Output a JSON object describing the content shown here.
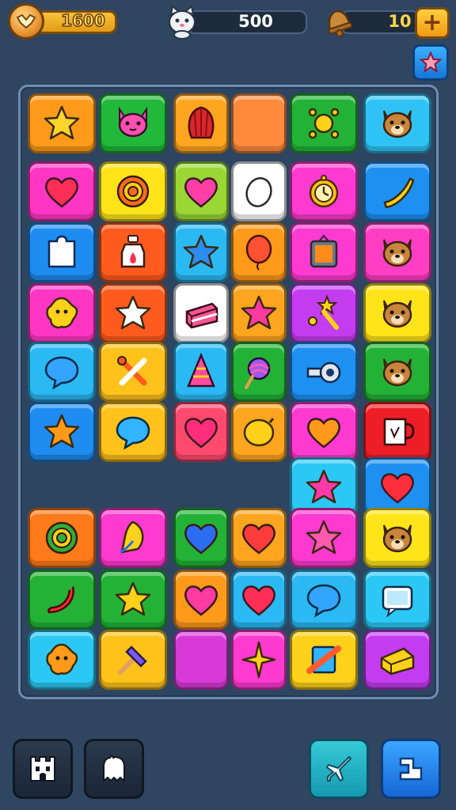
{
  "hud": {
    "coins": "1600",
    "score": "500",
    "bells": "10",
    "plus_label": "+"
  },
  "board": {
    "tiles": [
      {
        "color": "#ff9a1a",
        "icon": "star",
        "fg": "#ffd52b"
      },
      {
        "color": "#22b83a",
        "icon": "cat",
        "fg": "#ff4fb0"
      },
      {
        "color": "#ffa51f",
        "icon": "shell",
        "fg": "#d8262c"
      },
      {
        "color": "#ff8a3c",
        "icon": "none",
        "fg": "#ff8a3c"
      },
      {
        "color": "#23b236",
        "icon": "sun",
        "fg": "#ffd11a"
      },
      {
        "color": "#2fc3f5",
        "icon": "dog",
        "fg": "#c9853b"
      },
      {
        "color": "#ff36c4",
        "icon": "heart",
        "fg": "#ff2e56"
      },
      {
        "color": "#ffe41a",
        "icon": "target",
        "fg": "#ff6d1a"
      },
      {
        "color": "#9ad735",
        "icon": "heart",
        "fg": "#ff3fa8"
      },
      {
        "color": "#ffffff",
        "icon": "egg",
        "fg": "#ffffff"
      },
      {
        "color": "#ff3ad0",
        "icon": "clock",
        "fg": "#ffc21a"
      },
      {
        "color": "#1e90f2",
        "icon": "banana",
        "fg": "#ffd11a"
      },
      {
        "color": "#1e8cf0",
        "icon": "puzzle",
        "fg": "#ffffff"
      },
      {
        "color": "#ff5b1e",
        "icon": "bottle",
        "fg": "#ffffff"
      },
      {
        "color": "#2bb9f3",
        "icon": "star",
        "fg": "#2c8cf0"
      },
      {
        "color": "#ff9a1a",
        "icon": "balloon",
        "fg": "#ff5133"
      },
      {
        "color": "#ff3ad0",
        "icon": "frame",
        "fg": "#ff8c1a"
      },
      {
        "color": "#ff3ec4",
        "icon": "dog",
        "fg": "#c9853b"
      },
      {
        "color": "#ff36c4",
        "icon": "blob",
        "fg": "#ffd11a"
      },
      {
        "color": "#ff5b1e",
        "icon": "star",
        "fg": "#ffffff"
      },
      {
        "color": "#ffffff",
        "icon": "cake",
        "fg": "#ff5590"
      },
      {
        "color": "#ffa51f",
        "icon": "star",
        "fg": "#ff3aa0"
      },
      {
        "color": "#c43cf0",
        "icon": "wand",
        "fg": "#ffd11a"
      },
      {
        "color": "#ffe41a",
        "icon": "dog",
        "fg": "#c9853b"
      },
      {
        "color": "#2bb9f3",
        "icon": "bubble",
        "fg": "#33a4ff"
      },
      {
        "color": "#ffc21a",
        "icon": "tools",
        "fg": "#ff5b1e"
      },
      {
        "color": "#2bb9f3",
        "icon": "cone",
        "fg": "#ff4aa0"
      },
      {
        "color": "#23b236",
        "icon": "candy",
        "fg": "#9b5af0"
      },
      {
        "color": "#1e90f2",
        "icon": "whistle",
        "fg": "#e0e6f0"
      },
      {
        "color": "#23b236",
        "icon": "dog",
        "fg": "#c9853b"
      },
      {
        "color": "#1e8cf0",
        "icon": "star",
        "fg": "#ff9a1a"
      },
      {
        "color": "#ffc21a",
        "icon": "bubble",
        "fg": "#33b4ff"
      },
      {
        "color": "#ff4a6e",
        "icon": "heart",
        "fg": "#ff2e7a"
      },
      {
        "color": "#ffa51f",
        "icon": "lemon",
        "fg": "#ffd11a"
      },
      {
        "color": "#ff3ad0",
        "icon": "heart",
        "fg": "#ff9a1a"
      },
      {
        "color": "#ee1e26",
        "icon": "mug",
        "fg": "#ffffff"
      },
      {
        "color": "#2bc8f5",
        "icon": "star",
        "fg": "#ff3aa8"
      },
      {
        "color": "#1e90f2",
        "icon": "heart",
        "fg": "#ff2e3c"
      },
      {
        "color": "#ff7a1a",
        "icon": "target",
        "fg": "#2fae3a"
      },
      {
        "color": "#ff3ad0",
        "icon": "leaf",
        "fg": "#ffd11a"
      },
      {
        "color": "#23b236",
        "icon": "heart",
        "fg": "#2c6cf0"
      },
      {
        "color": "#ffa51f",
        "icon": "heart",
        "fg": "#ff3c3c"
      },
      {
        "color": "#ff3ad0",
        "icon": "star",
        "fg": "#ff5ab0"
      },
      {
        "color": "#ffe41a",
        "icon": "dog",
        "fg": "#c9853b"
      },
      {
        "color": "#23b236",
        "icon": "chili",
        "fg": "#ff2e2e"
      },
      {
        "color": "#23b236",
        "icon": "star",
        "fg": "#ffd11a"
      },
      {
        "color": "#ff9a1a",
        "icon": "heart",
        "fg": "#ff3aa0"
      },
      {
        "color": "#2bb9f3",
        "icon": "heart",
        "fg": "#ff2e56"
      },
      {
        "color": "#2bb9f3",
        "icon": "bubble",
        "fg": "#33a4ff"
      },
      {
        "color": "#2bc8f5",
        "icon": "screen",
        "fg": "#ffffff"
      },
      {
        "color": "#2bc8f5",
        "icon": "blob",
        "fg": "#ff9a1a"
      },
      {
        "color": "#ffc21a",
        "icon": "hammer",
        "fg": "#7b5af0"
      },
      {
        "color": "#d83ad8",
        "icon": "none",
        "fg": "#d83ad8"
      },
      {
        "color": "#ff3ad0",
        "icon": "sparkle",
        "fg": "#ffd11a"
      },
      {
        "color": "#ffd11a",
        "icon": "stick",
        "fg": "#ff5b2e"
      },
      {
        "color": "#c43cf0",
        "icon": "cheese",
        "fg": "#ffd11a"
      }
    ]
  },
  "buttons": {
    "bottom": [
      {
        "icon": "castle-icon",
        "style": "dark"
      },
      {
        "icon": "ghost-icon",
        "style": "dark"
      },
      {
        "icon": "plane-icon",
        "style": "teal"
      },
      {
        "icon": "swap-icon",
        "style": "blue"
      }
    ]
  }
}
